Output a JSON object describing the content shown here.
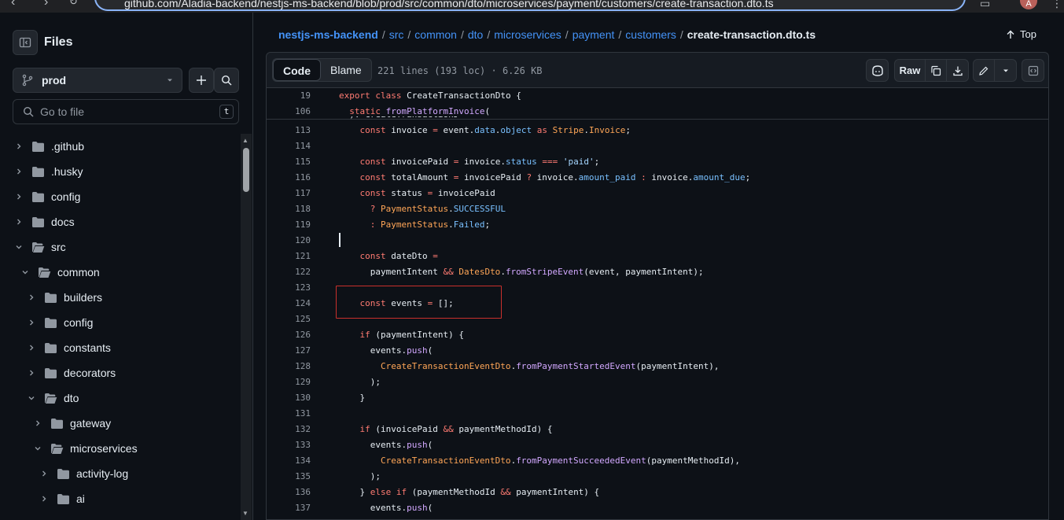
{
  "browser": {
    "url": "github.com/Aladia-backend/nestjs-ms-backend/blob/prod/src/common/dto/microservices/payment/customers/create-transaction.dto.ts",
    "profile_initial": "A"
  },
  "sidebar": {
    "title": "Files",
    "branch": "prod",
    "search_placeholder": "Go to file",
    "search_shortcut": "t",
    "tree": [
      {
        "label": ".github",
        "expanded": false
      },
      {
        "label": ".husky",
        "expanded": false
      },
      {
        "label": "config",
        "expanded": false
      },
      {
        "label": "docs",
        "expanded": false
      },
      {
        "label": "src",
        "expanded": true
      },
      {
        "label": "common",
        "expanded": true
      },
      {
        "label": "builders",
        "expanded": false
      },
      {
        "label": "config",
        "expanded": false
      },
      {
        "label": "constants",
        "expanded": false
      },
      {
        "label": "decorators",
        "expanded": false
      },
      {
        "label": "dto",
        "expanded": true
      },
      {
        "label": "gateway",
        "expanded": false
      },
      {
        "label": "microservices",
        "expanded": true
      },
      {
        "label": "activity-log",
        "expanded": false
      },
      {
        "label": "ai",
        "expanded": false
      }
    ]
  },
  "breadcrumb": {
    "repo": "nestjs-ms-backend",
    "parts": [
      "src",
      "common",
      "dto",
      "microservices",
      "payment",
      "customers"
    ],
    "current": "create-transaction.dto.ts",
    "top_label": "Top"
  },
  "file_header": {
    "tab_code": "Code",
    "tab_blame": "Blame",
    "info": "221 lines (193 loc) · 6.26 KB",
    "raw_label": "Raw"
  },
  "sticky_lines": [
    {
      "n": "19",
      "html": "<span class=\"kw\">export</span> <span class=\"kw\">class</span> CreateTransactionDto {"
    },
    {
      "n": "106",
      "html": "  <span class=\"kw\">static</span> <span class=\"fn\">fromPlatformInvoice</span>("
    }
  ],
  "code_lines": [
    {
      "n": "113",
      "html": "    <span class=\"kw\">const</span> invoice <span class=\"kw\">=</span> event.<span class=\"prop\">data</span>.<span class=\"prop\">object</span> <span class=\"kw\">as</span> <span class=\"cls\">Stripe</span>.<span class=\"cls\">Invoice</span>;"
    },
    {
      "n": "114",
      "html": ""
    },
    {
      "n": "115",
      "html": "    <span class=\"kw\">const</span> invoicePaid <span class=\"kw\">=</span> invoice.<span class=\"prop\">status</span> <span class=\"kw\">===</span> <span class=\"str\">'paid'</span>;"
    },
    {
      "n": "116",
      "html": "    <span class=\"kw\">const</span> totalAmount <span class=\"kw\">=</span> invoicePaid <span class=\"kw\">?</span> invoice.<span class=\"prop\">amount_paid</span> <span class=\"kw\">:</span> invoice.<span class=\"prop\">amount_due</span>;"
    },
    {
      "n": "117",
      "html": "    <span class=\"kw\">const</span> status <span class=\"kw\">=</span> invoicePaid"
    },
    {
      "n": "118",
      "html": "      <span class=\"kw\">?</span> <span class=\"cls\">PaymentStatus</span>.<span class=\"prop\">SUCCESSFUL</span>"
    },
    {
      "n": "119",
      "html": "      <span class=\"kw\">:</span> <span class=\"cls\">PaymentStatus</span>.<span class=\"prop\">Failed</span>;"
    },
    {
      "n": "120",
      "html": ""
    },
    {
      "n": "121",
      "html": "    <span class=\"kw\">const</span> dateDto <span class=\"kw\">=</span>"
    },
    {
      "n": "122",
      "html": "      paymentIntent <span class=\"kw\">&amp;&amp;</span> <span class=\"cls\">DatesDto</span>.<span class=\"fn\">fromStripeEvent</span>(event, paymentIntent);"
    },
    {
      "n": "123",
      "html": ""
    },
    {
      "n": "124",
      "html": "    <span class=\"kw\">const</span> events <span class=\"kw\">=</span> [];"
    },
    {
      "n": "125",
      "html": ""
    },
    {
      "n": "126",
      "html": "    <span class=\"kw\">if</span> (paymentIntent) {"
    },
    {
      "n": "127",
      "html": "      events.<span class=\"fn\">push</span>("
    },
    {
      "n": "128",
      "html": "        <span class=\"cls\">CreateTransactionEventDto</span>.<span class=\"fn\">fromPaymentStartedEvent</span>(paymentIntent),"
    },
    {
      "n": "129",
      "html": "      );"
    },
    {
      "n": "130",
      "html": "    }"
    },
    {
      "n": "131",
      "html": ""
    },
    {
      "n": "132",
      "html": "    <span class=\"kw\">if</span> (invoicePaid <span class=\"kw\">&amp;&amp;</span> paymentMethodId) {"
    },
    {
      "n": "133",
      "html": "      events.<span class=\"fn\">push</span>("
    },
    {
      "n": "134",
      "html": "        <span class=\"cls\">CreateTransactionEventDto</span>.<span class=\"fn\">fromPaymentSucceededEvent</span>(paymentMethodId),"
    },
    {
      "n": "135",
      "html": "      );"
    },
    {
      "n": "136",
      "html": "    } <span class=\"kw\">else</span> <span class=\"kw\">if</span> (paymentMethodId <span class=\"kw\">&amp;&amp;</span> paymentIntent) {"
    },
    {
      "n": "137",
      "html": "      events.<span class=\"fn\">push</span>("
    }
  ]
}
